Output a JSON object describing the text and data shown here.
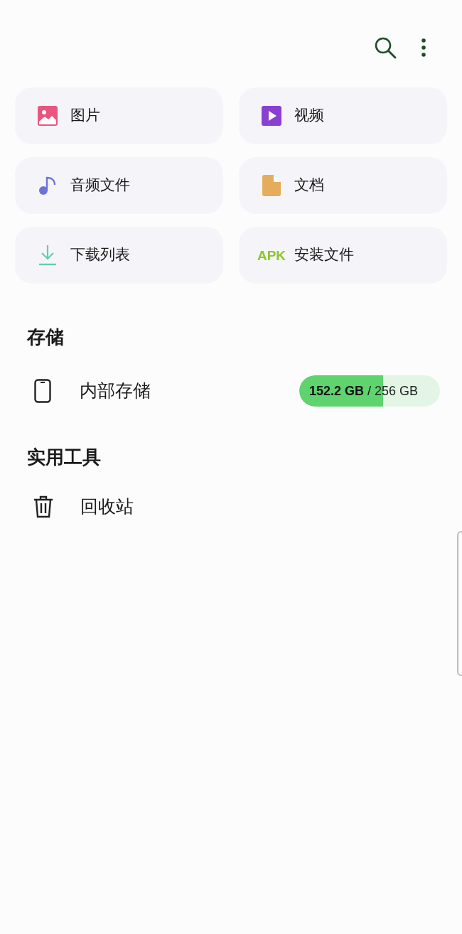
{
  "categories": [
    {
      "kind": "image",
      "label": "图片"
    },
    {
      "kind": "video",
      "label": "视频"
    },
    {
      "kind": "audio",
      "label": "音频文件"
    },
    {
      "kind": "document",
      "label": "文档"
    },
    {
      "kind": "download",
      "label": "下载列表"
    },
    {
      "kind": "apk",
      "label": "安装文件",
      "icon_text": "APK"
    }
  ],
  "storage": {
    "heading": "存储",
    "items": [
      {
        "label": "内部存储",
        "used": "152.2 GB",
        "separator": "/",
        "total": "256 GB",
        "level": 0.595
      }
    ]
  },
  "tools": {
    "heading": "实用工具",
    "items": [
      {
        "label": "回收站"
      }
    ]
  }
}
